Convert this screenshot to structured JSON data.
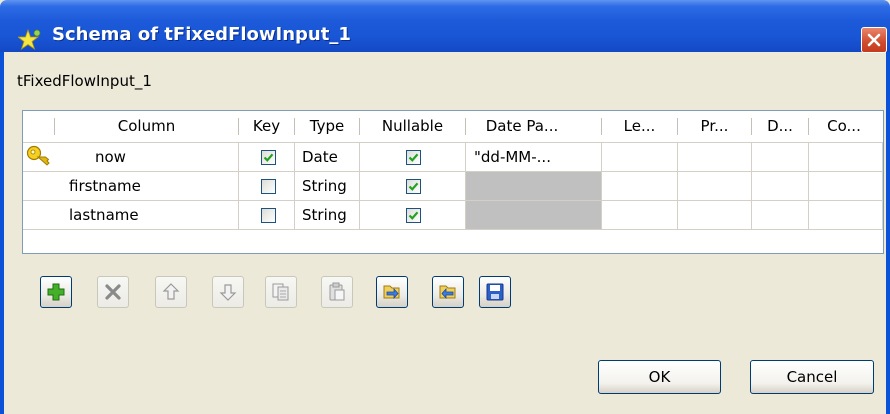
{
  "window": {
    "title": "Schema of tFixedFlowInput_1",
    "title_icon": "talend-star-icon",
    "close_icon": "close-icon"
  },
  "component_name": "tFixedFlowInput_1",
  "table": {
    "columns": [
      "Column",
      "Key",
      "Type",
      "Nullable",
      "Date Pa...",
      "Le...",
      "Pr...",
      "D...",
      "Co..."
    ],
    "rows": [
      {
        "key_icon": "key-icon",
        "column": "now",
        "key": true,
        "type": "Date",
        "nullable": true,
        "date_pattern": "\"dd-MM-...",
        "date_pattern_disabled": false
      },
      {
        "key_icon": "",
        "column": "firstname",
        "key": false,
        "type": "String",
        "nullable": true,
        "date_pattern": "",
        "date_pattern_disabled": true
      },
      {
        "key_icon": "",
        "column": "lastname",
        "key": false,
        "type": "String",
        "nullable": true,
        "date_pattern": "",
        "date_pattern_disabled": true
      }
    ]
  },
  "toolbar": [
    {
      "icon": "add-icon",
      "enabled": true
    },
    {
      "icon": "delete-icon",
      "enabled": false
    },
    {
      "icon": "move-up-icon",
      "enabled": false
    },
    {
      "icon": "move-down-icon",
      "enabled": false
    },
    {
      "icon": "copy-icon",
      "enabled": false
    },
    {
      "icon": "paste-icon",
      "enabled": false
    },
    {
      "icon": "import-icon",
      "enabled": true
    },
    {
      "icon": "export-icon",
      "enabled": true
    },
    {
      "icon": "save-icon",
      "enabled": true
    }
  ],
  "buttons": {
    "ok_label": "OK",
    "cancel_label": "Cancel"
  },
  "colors": {
    "title_bar": "#1956d6",
    "window_bg": "#ece9d8",
    "check": "#21a121",
    "disabled_cell": "#c0c0c0"
  }
}
